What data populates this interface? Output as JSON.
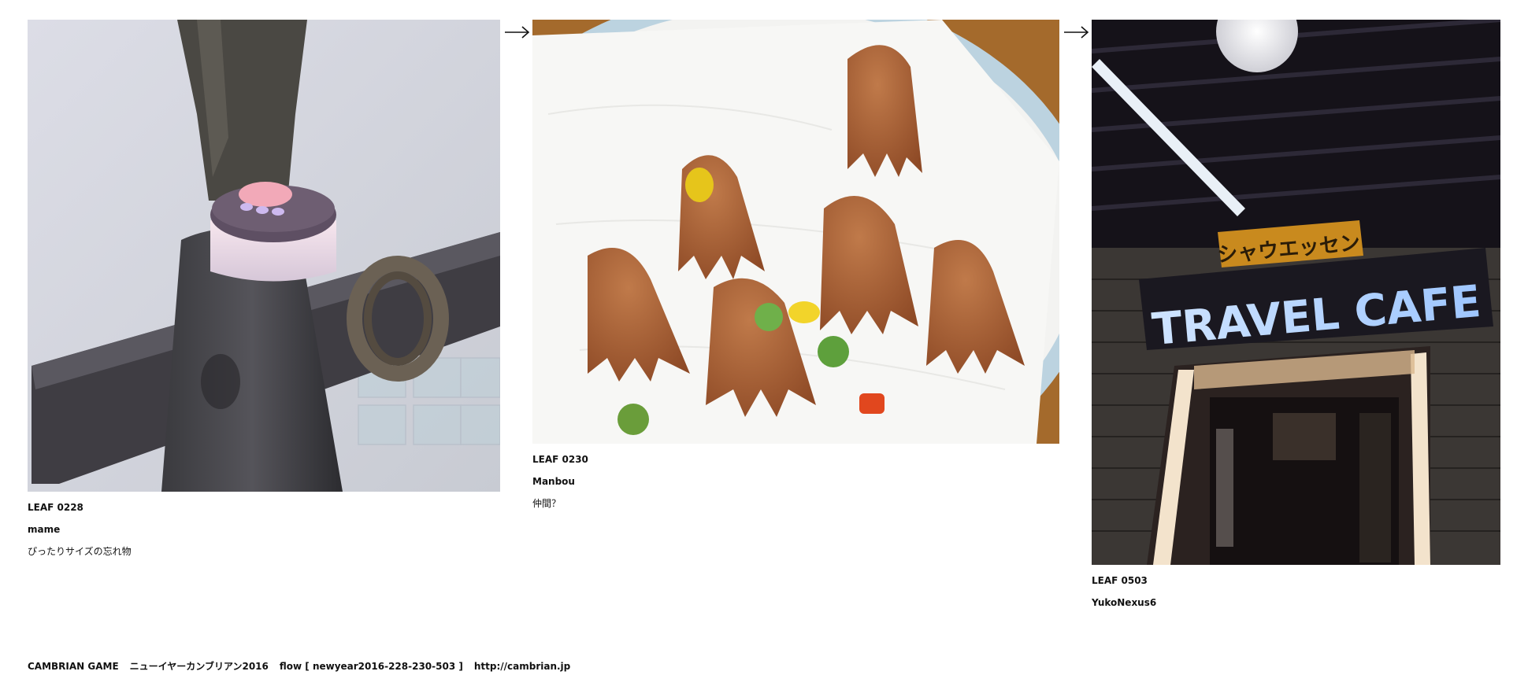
{
  "leaves": [
    {
      "id": "LEAF 0228",
      "author": "mame",
      "comment": "ぴったりサイズの忘れ物",
      "image_desc": "button-cap-on-wooden-post"
    },
    {
      "id": "LEAF 0230",
      "author": "Manbou",
      "comment": "仲間？",
      "image_desc": "octopus-sausages-on-plate"
    },
    {
      "id": "LEAF 0503",
      "author": "YukoNexus6",
      "comment": "",
      "image_desc": "travel-cafe-storefront-night",
      "sign_katakana": "シャウエッセン",
      "sign_text": "TRAVEL CAFE"
    }
  ],
  "footer": {
    "game": "CAMBRIAN GAME",
    "event": "ニューイヤーカンブリアン2016",
    "flow": "flow [ newyear2016-228-230-503 ]",
    "url": "http://cambrian.jp"
  },
  "colors": {
    "text": "#111111",
    "background": "#ffffff"
  },
  "icons": {
    "arrow": "right-arrow-icon"
  }
}
